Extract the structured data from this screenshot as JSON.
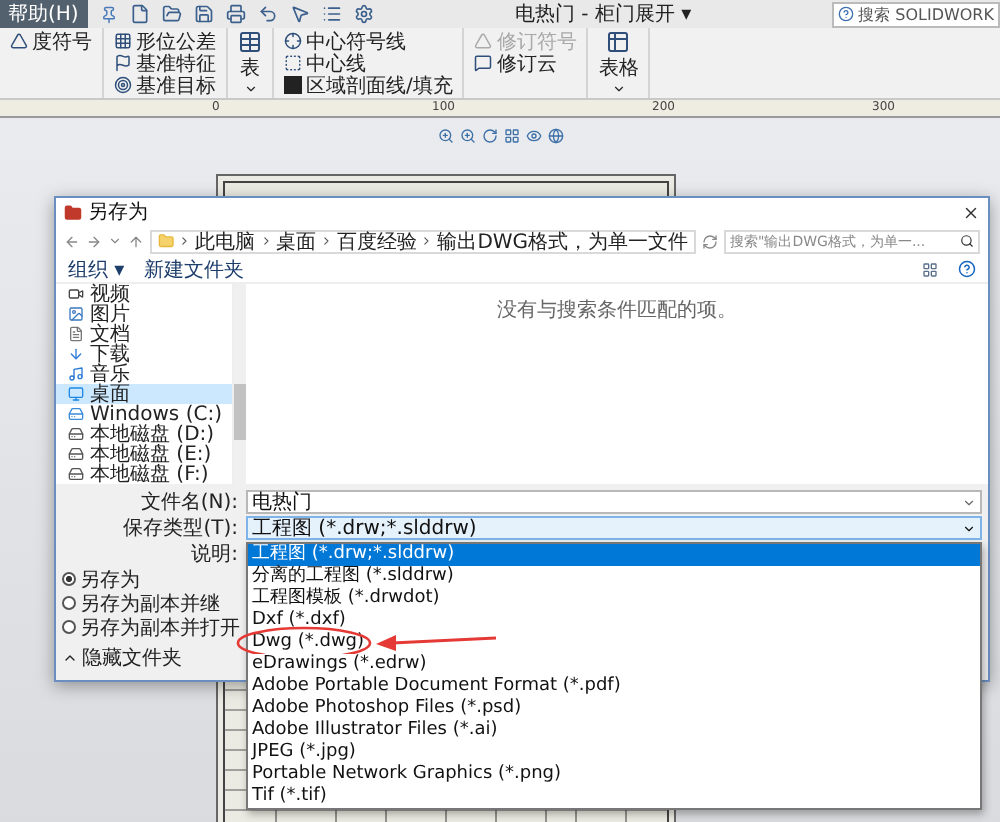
{
  "app": {
    "menu_tab": "帮助(H)",
    "document_title": "电热门 - 柜门展开 ▾",
    "search_text": "搜索 SOLIDWORK"
  },
  "ribbon": [
    {
      "kind": "stack",
      "items": [
        {
          "label": "度符号",
          "disabled": false
        }
      ]
    },
    {
      "kind": "stack",
      "items": [
        {
          "label": "形位公差",
          "disabled": false
        },
        {
          "label": "基准特征",
          "disabled": false
        },
        {
          "label": "基准目标",
          "disabled": false
        }
      ]
    },
    {
      "kind": "big",
      "items": [
        {
          "label": "表",
          "disabled": false
        }
      ]
    },
    {
      "kind": "stack",
      "items": [
        {
          "label": "中心符号线",
          "disabled": false
        },
        {
          "label": "中心线",
          "disabled": false
        },
        {
          "label": "区域剖面线/填充",
          "disabled": false
        }
      ]
    },
    {
      "kind": "stack",
      "items": [
        {
          "label": "修订符号",
          "disabled": true
        },
        {
          "label": "修订云",
          "disabled": false
        }
      ]
    },
    {
      "kind": "big",
      "items": [
        {
          "label": "表格",
          "disabled": false
        }
      ]
    }
  ],
  "ruler_labels": [
    "0",
    "100",
    "200",
    "300"
  ],
  "dialog": {
    "title": "另存为",
    "path": [
      "此电脑",
      "桌面",
      "百度经验",
      "输出DWG格式，为单一文件"
    ],
    "search_placeholder": "搜索\"输出DWG格式，为单一...",
    "commands": [
      "组织 ▾",
      "新建文件夹"
    ],
    "sidebar": [
      {
        "kind": "video",
        "label": "视频",
        "selected": false
      },
      {
        "kind": "picture",
        "label": "图片",
        "selected": false
      },
      {
        "kind": "document",
        "label": "文档",
        "selected": false
      },
      {
        "kind": "download",
        "label": "下载",
        "selected": false
      },
      {
        "kind": "music",
        "label": "音乐",
        "selected": false
      },
      {
        "kind": "desktop",
        "label": "桌面",
        "selected": true
      },
      {
        "kind": "system_drive",
        "label": "Windows (C:)",
        "selected": false
      },
      {
        "kind": "drive",
        "label": "本地磁盘 (D:)",
        "selected": false
      },
      {
        "kind": "drive",
        "label": "本地磁盘 (E:)",
        "selected": false
      },
      {
        "kind": "drive",
        "label": "本地磁盘 (F:)",
        "selected": false
      }
    ],
    "empty_message": "没有与搜索条件匹配的项。",
    "file_name_label": "文件名(N):",
    "file_name": "电热门",
    "type_label": "保存类型(T):",
    "type_value": "工程图 (*.drw;*.slddrw)",
    "description_label": "说明:",
    "save_options": [
      {
        "label": "另存为",
        "selected": true
      },
      {
        "label": "另存为副本并继",
        "selected": false
      },
      {
        "label": "另存为副本并打开",
        "selected": false
      }
    ],
    "hide_folders": "隐藏文件夹",
    "type_options": [
      {
        "label": "工程图 (*.drw;*.slddrw)",
        "selected": true,
        "circled": false
      },
      {
        "label": "分离的工程图 (*.slddrw)",
        "selected": false,
        "circled": false
      },
      {
        "label": "工程图模板 (*.drwdot)",
        "selected": false,
        "circled": false
      },
      {
        "label": "Dxf (*.dxf)",
        "selected": false,
        "circled": false
      },
      {
        "label": "Dwg (*.dwg)",
        "selected": false,
        "circled": true
      },
      {
        "label": "eDrawings (*.edrw)",
        "selected": false,
        "circled": false
      },
      {
        "label": "Adobe Portable Document Format (*.pdf)",
        "selected": false,
        "circled": false
      },
      {
        "label": "Adobe Photoshop Files (*.psd)",
        "selected": false,
        "circled": false
      },
      {
        "label": "Adobe Illustrator Files (*.ai)",
        "selected": false,
        "circled": false
      },
      {
        "label": "JPEG (*.jpg)",
        "selected": false,
        "circled": false
      },
      {
        "label": "Portable Network Graphics (*.png)",
        "selected": false,
        "circled": false
      },
      {
        "label": "Tif (*.tif)",
        "selected": false,
        "circled": false
      }
    ]
  }
}
